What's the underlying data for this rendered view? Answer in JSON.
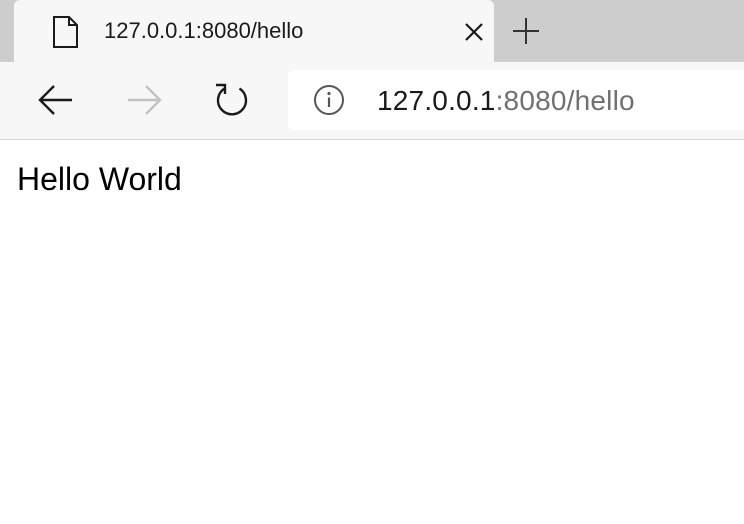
{
  "browser": {
    "tab": {
      "title": "127.0.0.1:8080/hello",
      "favicon": "page-icon",
      "close_icon": "close-icon"
    },
    "new_tab_icon": "plus-icon",
    "toolbar": {
      "back_icon": "arrow-left-icon",
      "forward_icon": "arrow-right-icon",
      "forward_enabled": false,
      "refresh_icon": "refresh-icon"
    },
    "address_bar": {
      "info_icon": "info-icon",
      "url_host": "127.0.0.1",
      "url_rest": ":8080/hello"
    },
    "colors": {
      "tabstrip_bg": "#cdcdcd",
      "toolbar_bg": "#f7f7f7",
      "url_host": "#1a1a1a",
      "url_rest": "#707070",
      "disabled_icon": "#c2c2c2"
    }
  },
  "page": {
    "body_text": "Hello World"
  }
}
